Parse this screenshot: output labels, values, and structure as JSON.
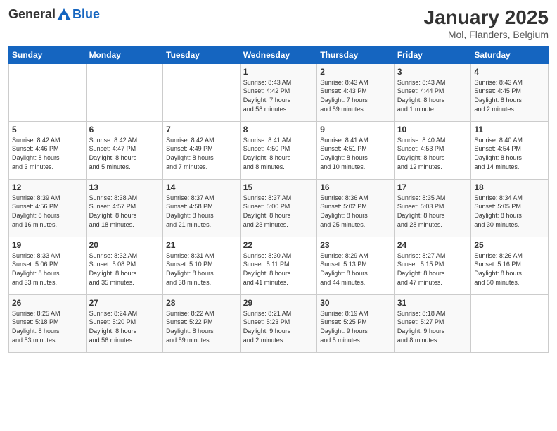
{
  "logo": {
    "general": "General",
    "blue": "Blue"
  },
  "header": {
    "month": "January 2025",
    "location": "Mol, Flanders, Belgium"
  },
  "days_of_week": [
    "Sunday",
    "Monday",
    "Tuesday",
    "Wednesday",
    "Thursday",
    "Friday",
    "Saturday"
  ],
  "weeks": [
    [
      {
        "day": "",
        "info": ""
      },
      {
        "day": "",
        "info": ""
      },
      {
        "day": "",
        "info": ""
      },
      {
        "day": "1",
        "info": "Sunrise: 8:43 AM\nSunset: 4:42 PM\nDaylight: 7 hours\nand 58 minutes."
      },
      {
        "day": "2",
        "info": "Sunrise: 8:43 AM\nSunset: 4:43 PM\nDaylight: 7 hours\nand 59 minutes."
      },
      {
        "day": "3",
        "info": "Sunrise: 8:43 AM\nSunset: 4:44 PM\nDaylight: 8 hours\nand 1 minute."
      },
      {
        "day": "4",
        "info": "Sunrise: 8:43 AM\nSunset: 4:45 PM\nDaylight: 8 hours\nand 2 minutes."
      }
    ],
    [
      {
        "day": "5",
        "info": "Sunrise: 8:42 AM\nSunset: 4:46 PM\nDaylight: 8 hours\nand 3 minutes."
      },
      {
        "day": "6",
        "info": "Sunrise: 8:42 AM\nSunset: 4:47 PM\nDaylight: 8 hours\nand 5 minutes."
      },
      {
        "day": "7",
        "info": "Sunrise: 8:42 AM\nSunset: 4:49 PM\nDaylight: 8 hours\nand 7 minutes."
      },
      {
        "day": "8",
        "info": "Sunrise: 8:41 AM\nSunset: 4:50 PM\nDaylight: 8 hours\nand 8 minutes."
      },
      {
        "day": "9",
        "info": "Sunrise: 8:41 AM\nSunset: 4:51 PM\nDaylight: 8 hours\nand 10 minutes."
      },
      {
        "day": "10",
        "info": "Sunrise: 8:40 AM\nSunset: 4:53 PM\nDaylight: 8 hours\nand 12 minutes."
      },
      {
        "day": "11",
        "info": "Sunrise: 8:40 AM\nSunset: 4:54 PM\nDaylight: 8 hours\nand 14 minutes."
      }
    ],
    [
      {
        "day": "12",
        "info": "Sunrise: 8:39 AM\nSunset: 4:56 PM\nDaylight: 8 hours\nand 16 minutes."
      },
      {
        "day": "13",
        "info": "Sunrise: 8:38 AM\nSunset: 4:57 PM\nDaylight: 8 hours\nand 18 minutes."
      },
      {
        "day": "14",
        "info": "Sunrise: 8:37 AM\nSunset: 4:58 PM\nDaylight: 8 hours\nand 21 minutes."
      },
      {
        "day": "15",
        "info": "Sunrise: 8:37 AM\nSunset: 5:00 PM\nDaylight: 8 hours\nand 23 minutes."
      },
      {
        "day": "16",
        "info": "Sunrise: 8:36 AM\nSunset: 5:02 PM\nDaylight: 8 hours\nand 25 minutes."
      },
      {
        "day": "17",
        "info": "Sunrise: 8:35 AM\nSunset: 5:03 PM\nDaylight: 8 hours\nand 28 minutes."
      },
      {
        "day": "18",
        "info": "Sunrise: 8:34 AM\nSunset: 5:05 PM\nDaylight: 8 hours\nand 30 minutes."
      }
    ],
    [
      {
        "day": "19",
        "info": "Sunrise: 8:33 AM\nSunset: 5:06 PM\nDaylight: 8 hours\nand 33 minutes."
      },
      {
        "day": "20",
        "info": "Sunrise: 8:32 AM\nSunset: 5:08 PM\nDaylight: 8 hours\nand 35 minutes."
      },
      {
        "day": "21",
        "info": "Sunrise: 8:31 AM\nSunset: 5:10 PM\nDaylight: 8 hours\nand 38 minutes."
      },
      {
        "day": "22",
        "info": "Sunrise: 8:30 AM\nSunset: 5:11 PM\nDaylight: 8 hours\nand 41 minutes."
      },
      {
        "day": "23",
        "info": "Sunrise: 8:29 AM\nSunset: 5:13 PM\nDaylight: 8 hours\nand 44 minutes."
      },
      {
        "day": "24",
        "info": "Sunrise: 8:27 AM\nSunset: 5:15 PM\nDaylight: 8 hours\nand 47 minutes."
      },
      {
        "day": "25",
        "info": "Sunrise: 8:26 AM\nSunset: 5:16 PM\nDaylight: 8 hours\nand 50 minutes."
      }
    ],
    [
      {
        "day": "26",
        "info": "Sunrise: 8:25 AM\nSunset: 5:18 PM\nDaylight: 8 hours\nand 53 minutes."
      },
      {
        "day": "27",
        "info": "Sunrise: 8:24 AM\nSunset: 5:20 PM\nDaylight: 8 hours\nand 56 minutes."
      },
      {
        "day": "28",
        "info": "Sunrise: 8:22 AM\nSunset: 5:22 PM\nDaylight: 8 hours\nand 59 minutes."
      },
      {
        "day": "29",
        "info": "Sunrise: 8:21 AM\nSunset: 5:23 PM\nDaylight: 9 hours\nand 2 minutes."
      },
      {
        "day": "30",
        "info": "Sunrise: 8:19 AM\nSunset: 5:25 PM\nDaylight: 9 hours\nand 5 minutes."
      },
      {
        "day": "31",
        "info": "Sunrise: 8:18 AM\nSunset: 5:27 PM\nDaylight: 9 hours\nand 8 minutes."
      },
      {
        "day": "",
        "info": ""
      }
    ]
  ]
}
